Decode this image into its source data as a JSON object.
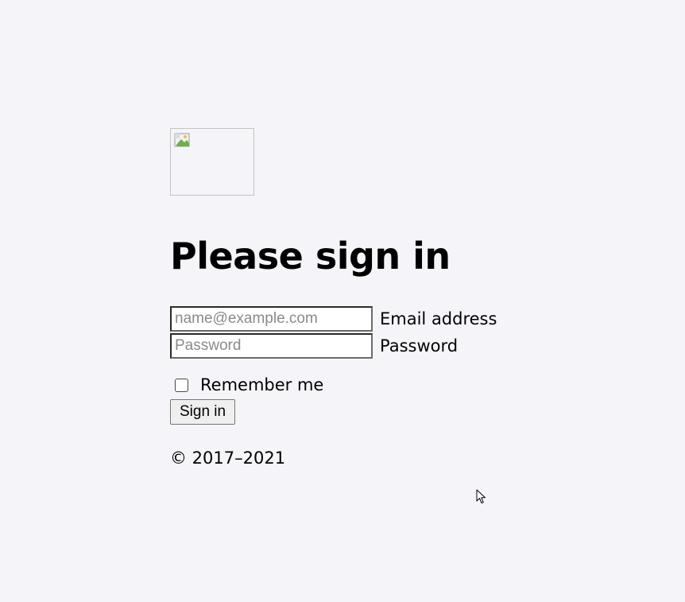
{
  "page": {
    "background": "#f5f4f8"
  },
  "logo": {
    "icon": "broken-image-icon"
  },
  "form": {
    "heading": "Please sign in",
    "email": {
      "placeholder": "name@example.com",
      "value": "",
      "label": "Email address"
    },
    "password": {
      "placeholder": "Password",
      "value": "",
      "label": "Password"
    },
    "remember": {
      "label": "Remember me",
      "checked": false
    },
    "submit_label": "Sign in"
  },
  "footer": {
    "copyright": "© 2017–2021"
  },
  "pointer": {
    "icon": "mouse-cursor-icon"
  }
}
